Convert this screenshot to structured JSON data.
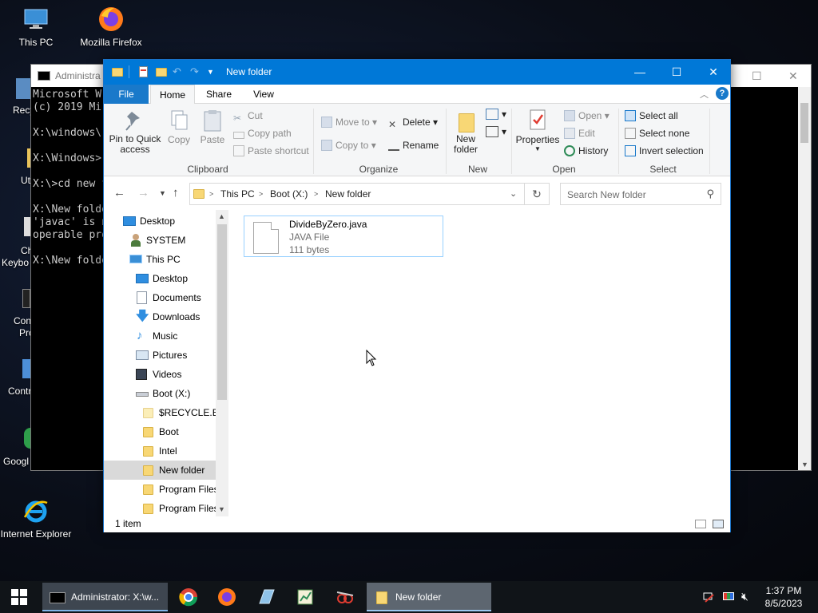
{
  "desktop": {
    "icons": [
      {
        "label": "This PC"
      },
      {
        "label": "Mozilla Firefox"
      },
      {
        "label": "Internet Explorer"
      }
    ],
    "partial_labels": [
      "Recy",
      "Ut",
      "Ch",
      "Keybo",
      "Con",
      "Pro",
      "Contr",
      "Googl"
    ]
  },
  "console": {
    "title": "Administra",
    "lines": "Microsoft W\n(c) 2019 Mi\n\nX:\\windows\\\n\nX:\\Windows>\n\nX:\\>cd new f\n\nX:\\New folde\n'javac' is n\noperable pro\n\nX:\\New folde"
  },
  "explorer": {
    "title": "New folder",
    "tabs": {
      "file": "File",
      "home": "Home",
      "share": "Share",
      "view": "View"
    },
    "ribbon": {
      "clipboard": {
        "label": "Clipboard",
        "pin": "Pin to Quick access",
        "copy": "Copy",
        "paste": "Paste",
        "cut": "Cut",
        "copy_path": "Copy path",
        "paste_shortcut": "Paste shortcut"
      },
      "organize": {
        "label": "Organize",
        "move_to": "Move to",
        "copy_to": "Copy to",
        "delete": "Delete",
        "rename": "Rename"
      },
      "new": {
        "label": "New",
        "new_folder": "New folder"
      },
      "open": {
        "label": "Open",
        "properties": "Properties",
        "open": "Open",
        "edit": "Edit",
        "history": "History"
      },
      "select": {
        "label": "Select",
        "select_all": "Select all",
        "select_none": "Select none",
        "invert": "Invert selection"
      }
    },
    "address": {
      "crumbs": [
        "This PC",
        "Boot (X:)",
        "New folder"
      ]
    },
    "search": {
      "placeholder": "Search New folder"
    },
    "nav": [
      {
        "label": "Desktop"
      },
      {
        "label": "SYSTEM"
      },
      {
        "label": "This PC"
      },
      {
        "label": "Desktop"
      },
      {
        "label": "Documents"
      },
      {
        "label": "Downloads"
      },
      {
        "label": "Music"
      },
      {
        "label": "Pictures"
      },
      {
        "label": "Videos"
      },
      {
        "label": "Boot (X:)"
      },
      {
        "label": "$RECYCLE.BIN"
      },
      {
        "label": "Boot"
      },
      {
        "label": "Intel"
      },
      {
        "label": "New folder"
      },
      {
        "label": "Program Files"
      },
      {
        "label": "Program Files"
      }
    ],
    "files": [
      {
        "name": "DivideByZero.java",
        "type": "JAVA File",
        "size": "111 bytes"
      }
    ],
    "status": "1 item"
  },
  "taskbar": {
    "tasks": [
      {
        "label": "Administrator: X:\\w..."
      },
      {
        "label": "New folder"
      }
    ],
    "time": "1:37 PM",
    "date": "8/5/2023"
  },
  "colors": {
    "accent": "#0078d7",
    "taskbar": "#101418",
    "folder": "#f8d775"
  }
}
